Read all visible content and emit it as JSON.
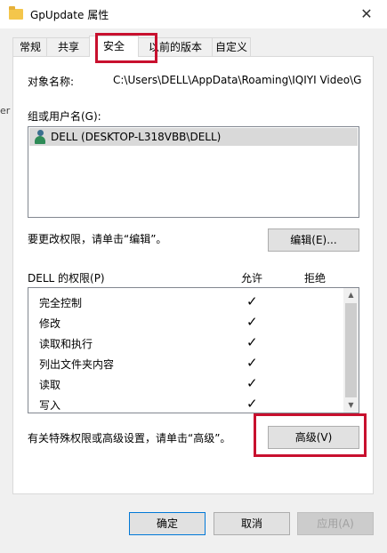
{
  "window": {
    "title": "GpUpdate 属性",
    "close_icon": "✕"
  },
  "cut_text": "er",
  "tabs": [
    "常规",
    "共享",
    "安全",
    "以前的版本",
    "自定义"
  ],
  "active_tab": "安全",
  "security": {
    "object_label": "对象名称:",
    "object_path": "C:\\Users\\DELL\\AppData\\Roaming\\IQIYI Video\\G",
    "groups_label": "组或用户名(G):",
    "users": [
      "DELL (DESKTOP-L318VBB\\DELL)"
    ],
    "edit_hint": "要更改权限，请单击“编辑”。",
    "edit_button": "编辑(E)...",
    "permissions_label": "DELL 的权限(P)",
    "allow_header": "允许",
    "deny_header": "拒绝",
    "permissions": [
      {
        "name": "完全控制",
        "allow": "✓"
      },
      {
        "name": "修改",
        "allow": "✓"
      },
      {
        "name": "读取和执行",
        "allow": "✓"
      },
      {
        "name": "列出文件夹内容",
        "allow": "✓"
      },
      {
        "name": "读取",
        "allow": "✓"
      },
      {
        "name": "写入",
        "allow": "✓"
      }
    ],
    "advanced_hint": "有关特殊权限或高级设置，请单击“高级”。",
    "advanced_button": "高级(V)"
  },
  "footer": {
    "ok": "确定",
    "cancel": "取消",
    "apply": "应用(A)"
  },
  "colors": {
    "highlight": "#c8102e",
    "selected_row": "#d9d9d9"
  }
}
